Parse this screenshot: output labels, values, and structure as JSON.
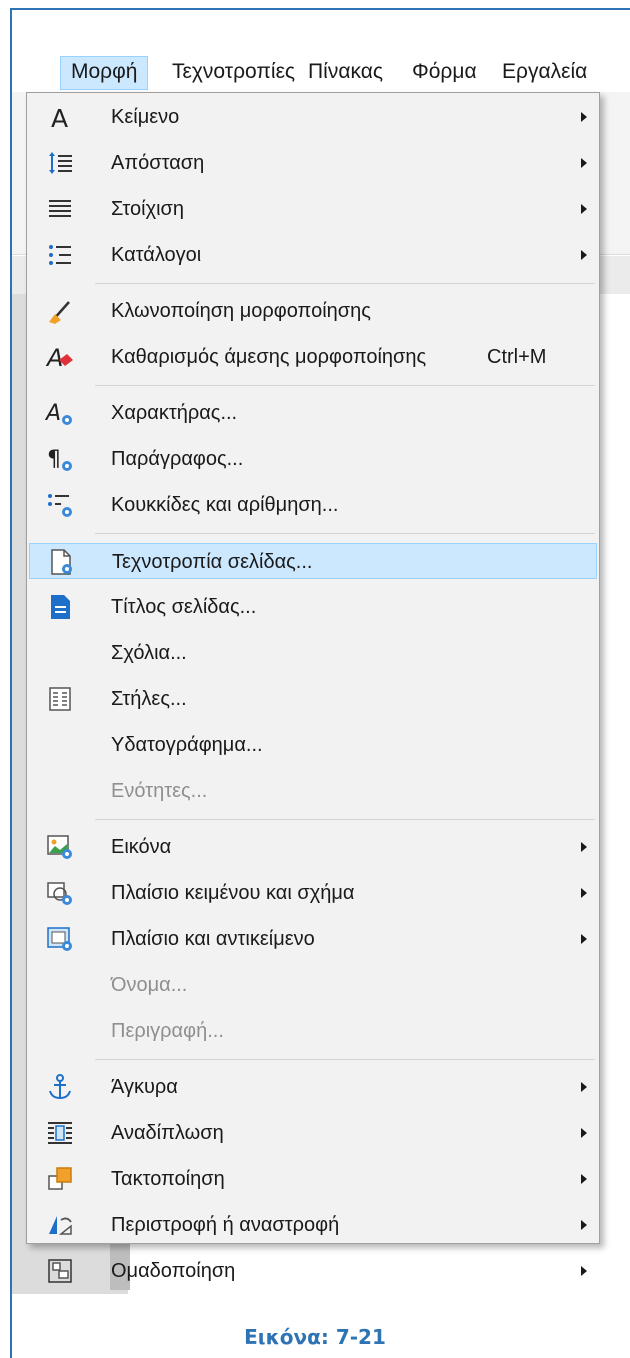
{
  "colors": {
    "accent": "#2e74b5",
    "highlight_bg": "#cce8ff",
    "highlight_border": "#99d1ff",
    "menu_bg": "#f2f2f2",
    "disabled_text": "#8f8f8f"
  },
  "menubar": {
    "format": "Μορφή",
    "styles": "Τεχνοτροπίες",
    "table": "Πίνακας",
    "form": "Φόρμα",
    "tools": "Εργαλεία"
  },
  "menu": {
    "items": [
      {
        "label": "Κείμενο",
        "icon": "text-icon",
        "submenu": true
      },
      {
        "label": "Απόσταση",
        "icon": "spacing-icon",
        "submenu": true
      },
      {
        "label": "Στοίχιση",
        "icon": "align-icon",
        "submenu": true
      },
      {
        "label": "Κατάλογοι",
        "icon": "list-icon",
        "submenu": true
      },
      {
        "label": "Κλωνοποίηση μορφοποίησης",
        "icon": "clone-formatting-icon"
      },
      {
        "label": "Καθαρισμός άμεσης μορφοποίησης",
        "icon": "clear-formatting-icon",
        "shortcut": "Ctrl+M"
      },
      {
        "label": "Χαρακτήρας...",
        "icon": "character-icon"
      },
      {
        "label": "Παράγραφος...",
        "icon": "paragraph-icon"
      },
      {
        "label": "Κουκκίδες και αρίθμηση...",
        "icon": "bullets-numbering-icon"
      },
      {
        "label": "Τεχνοτροπία σελίδας...",
        "icon": "page-style-icon",
        "highlighted": true
      },
      {
        "label": "Τίτλος σελίδας...",
        "icon": "title-page-icon"
      },
      {
        "label": "Σχόλια..."
      },
      {
        "label": "Στήλες...",
        "icon": "columns-icon"
      },
      {
        "label": "Υδατογράφημα..."
      },
      {
        "label": "Ενότητες...",
        "disabled": true
      },
      {
        "label": "Εικόνα",
        "icon": "image-icon",
        "submenu": true
      },
      {
        "label": "Πλαίσιο κειμένου και σχήμα",
        "icon": "text-box-shape-icon",
        "submenu": true
      },
      {
        "label": "Πλαίσιο και αντικείμενο",
        "icon": "frame-object-icon",
        "submenu": true
      },
      {
        "label": "Όνομα...",
        "disabled": true
      },
      {
        "label": "Περιγραφή...",
        "disabled": true
      },
      {
        "label": "Άγκυρα",
        "icon": "anchor-icon",
        "submenu": true
      },
      {
        "label": "Αναδίπλωση",
        "icon": "wrap-icon",
        "submenu": true
      },
      {
        "label": "Τακτοποίηση",
        "icon": "arrange-icon",
        "submenu": true
      },
      {
        "label": "Περιστροφή ή αναστροφή",
        "icon": "rotate-flip-icon",
        "submenu": true
      },
      {
        "label": "Ομαδοποίηση",
        "icon": "group-icon",
        "submenu": true
      }
    ]
  },
  "caption": "Εικόνα: 7-21"
}
